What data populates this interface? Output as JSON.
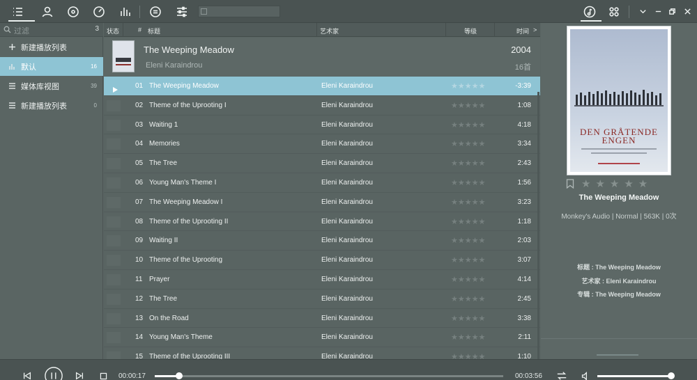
{
  "toolbar": {
    "icons": [
      "playlist-icon",
      "artist-icon",
      "album-icon",
      "dashboard-icon",
      "equalizer-bars-icon",
      "equal-circle-icon",
      "sliders-icon"
    ],
    "search_placeholder": "",
    "right_icons": [
      "music-note-icon",
      "grid-icon",
      "chevron-down-icon",
      "minimize-icon",
      "restore-icon",
      "close-icon"
    ]
  },
  "sidebar": {
    "search_placeholder": "过滤",
    "count": "3",
    "items": [
      {
        "label": "新建播放列表",
        "count": "",
        "icon": "plus-icon",
        "active": false
      },
      {
        "label": "默认",
        "count": "16",
        "icon": "equalizer-bars-icon",
        "active": true
      },
      {
        "label": "媒体库视图",
        "count": "39",
        "icon": "list-icon",
        "active": false
      },
      {
        "label": "新建播放列表",
        "count": "0",
        "icon": "list-icon",
        "active": false
      }
    ]
  },
  "columns": {
    "status": "状态",
    "number": "#",
    "title": "标题",
    "artist": "艺术家",
    "rating": "等级",
    "time": "时间",
    "more": ">"
  },
  "album": {
    "title": "The Weeping Meadow",
    "artist": "Eleni Karaindrou",
    "year": "2004",
    "count": "16首"
  },
  "tracks": [
    {
      "no": "01",
      "title": "The Weeping Meadow",
      "artist": "Eleni Karaindrou",
      "time": "-3:39",
      "playing": true
    },
    {
      "no": "02",
      "title": "Theme of the Uprooting I",
      "artist": "Eleni Karaindrou",
      "time": "1:08"
    },
    {
      "no": "03",
      "title": "Waiting 1",
      "artist": "Eleni Karaindrou",
      "time": "4:18"
    },
    {
      "no": "04",
      "title": "Memories",
      "artist": "Eleni Karaindrou",
      "time": "3:34"
    },
    {
      "no": "05",
      "title": "The Tree",
      "artist": "Eleni Karaindrou",
      "time": "2:43"
    },
    {
      "no": "06",
      "title": "Young Man's Theme I",
      "artist": "Eleni Karaindrou",
      "time": "1:56"
    },
    {
      "no": "07",
      "title": "The Weeping Meadow I",
      "artist": "Eleni Karaindrou",
      "time": "3:23"
    },
    {
      "no": "08",
      "title": "Theme of the Uprooting II",
      "artist": "Eleni Karaindrou",
      "time": "1:18"
    },
    {
      "no": "09",
      "title": "Waiting II",
      "artist": "Eleni Karaindrou",
      "time": "2:03"
    },
    {
      "no": "10",
      "title": "Theme of the Uprooting",
      "artist": "Eleni Karaindrou",
      "time": "3:07"
    },
    {
      "no": "11",
      "title": "Prayer",
      "artist": "Eleni Karaindrou",
      "time": "4:14"
    },
    {
      "no": "12",
      "title": "The Tree",
      "artist": "Eleni Karaindrou",
      "time": "2:45"
    },
    {
      "no": "13",
      "title": "On the Road",
      "artist": "Eleni Karaindrou",
      "time": "3:38"
    },
    {
      "no": "14",
      "title": "Young Man's Theme",
      "artist": "Eleni Karaindrou",
      "time": "2:11"
    },
    {
      "no": "15",
      "title": "Theme of the Uprooting III",
      "artist": "Eleni Karaindrou",
      "time": "1:10"
    }
  ],
  "now_playing": {
    "cover_title": "DEN GRÅTENDE ENGEN",
    "title": "The Weeping Meadow",
    "format": "Monkey's Audio | Normal | 563K | 0次",
    "meta_title": "标题 : The Weeping Meadow",
    "meta_artist": "艺术家 : Eleni Karaindrou",
    "meta_album": "专辑 : The Weeping Meadow",
    "rating_stars": "★★★★★"
  },
  "player": {
    "current_time": "00:00:17",
    "total_time": "00:03:56",
    "progress": 0.07,
    "volume": 0.98
  },
  "colors": {
    "accent": "#8ec4d4",
    "background": "#5a6563",
    "toolbar": "#4a5352"
  }
}
